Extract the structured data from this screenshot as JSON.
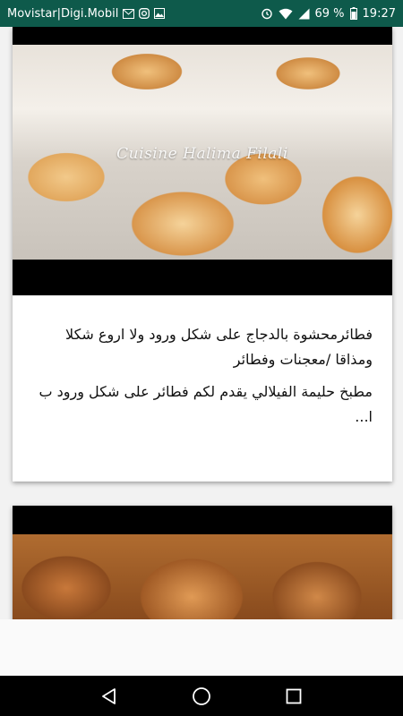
{
  "status_bar": {
    "carrier": "Movistar|Digi.Mobil",
    "battery": "69 %",
    "time": "19:27",
    "icons_left": [
      "mail-icon",
      "instagram-icon",
      "image-icon"
    ],
    "icons_right": [
      "alarm-icon",
      "wifi-icon",
      "signal-icon",
      "battery-icon"
    ],
    "background_color": "#0e5a4b"
  },
  "cards": [
    {
      "watermark": "Cuisine Halima Filali",
      "title": "فطائرمحشوة بالدجاج على شكل ورود ولا اروع شكلا ومذاقا /معجنات وفطائر",
      "description": "مطبخ حليمة الفيلالي يقدم لكم فطائر على شكل ورود ب ا..."
    },
    {
      "watermark": "",
      "title": "",
      "description": ""
    }
  ],
  "nav_bar": {
    "buttons": [
      "back-icon",
      "home-icon",
      "recents-icon"
    ]
  }
}
